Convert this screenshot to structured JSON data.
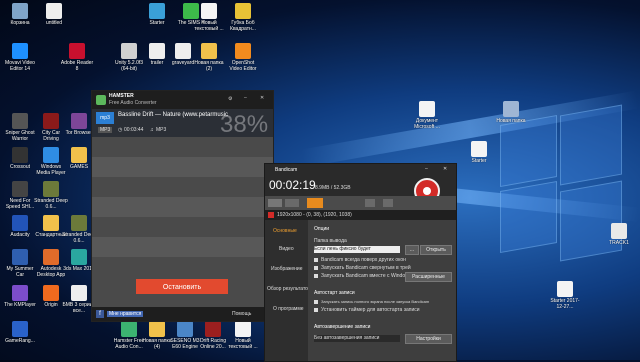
{
  "desktop_icons": [
    {
      "label": "Корзина"
    },
    {
      "label": "untitled"
    },
    {
      "label": "Starter"
    },
    {
      "label": "The SIMS 4"
    },
    {
      "label": "Новый текстовый ..."
    },
    {
      "label": "Губка Боб Квадратн..."
    },
    {
      "label": "Movavi Video Editor 14"
    },
    {
      "label": "Adobe Reader 8"
    },
    {
      "label": "Unity 5.2.0f3 (64-bit)"
    },
    {
      "label": "trailer"
    },
    {
      "label": "graveyard"
    },
    {
      "label": "Новая папка (2)"
    },
    {
      "label": "OpenShot Video Editor"
    },
    {
      "label": "Sniper Ghost Warrior"
    },
    {
      "label": "City Car Driving"
    },
    {
      "label": "Tor Browser"
    },
    {
      "label": "Crossout"
    },
    {
      "label": "Windows Media Player"
    },
    {
      "label": "GAMES"
    },
    {
      "label": "Need For Speed SHI..."
    },
    {
      "label": "Stranded Deep 0.6..."
    },
    {
      "label": "Audacity"
    },
    {
      "label": "Стандартные"
    },
    {
      "label": "Stranded Deep 0.6..."
    },
    {
      "label": "My Summer Car"
    },
    {
      "label": "Autodesk Desktop App"
    },
    {
      "label": "3ds Max 2017"
    },
    {
      "label": "БМВ 3 серии - все..."
    },
    {
      "label": "The KMPlayer"
    },
    {
      "label": "Origin"
    },
    {
      "label": "GameRang..."
    },
    {
      "label": "Hamster Free Audio Con..."
    },
    {
      "label": "Новая папка (4)"
    },
    {
      "label": "SESENO М3 E60 Engine"
    },
    {
      "label": "Drift Racing Online 20..."
    },
    {
      "label": "Новый текстовый ..."
    },
    {
      "label": "Документ Microsoft ..."
    },
    {
      "label": "Новая папка"
    },
    {
      "label": "Starter"
    },
    {
      "label": "Starter 2017-12-27..."
    },
    {
      "label": "TRACK1"
    }
  ],
  "hamster": {
    "title": "HAMSTER",
    "subtitle": "Free Audio Converter",
    "track_name": "Bassline Drift — Nature (www.petarmusic",
    "duration": "00:03:44",
    "format_badge": "MP3",
    "format_label": "MP3",
    "progress_text": "38%",
    "convert_button": "Остановить",
    "like_label": "Мне нравится",
    "help_label": "Помощь"
  },
  "bandicam": {
    "title": "Bandicam",
    "timer": "00:02:19",
    "size": "8.9MB / 52.3GB",
    "target": "1920x1080 - (0, 38), (1920, 1038)",
    "side_items": [
      "Основные",
      "Видео",
      "Изображение",
      "Обзор результатов",
      "О программе"
    ],
    "section_options": "Опции",
    "output_folder_label": "Папка вывода",
    "output_folder_value": "Если лень фиксио будет",
    "browse_button": "...",
    "open_button": "Открыть",
    "options": [
      "Bandicam всегда поверх других окон",
      "Запускать Bandicam свернутым в трей",
      "Запускать Bandicam вместе с Windows"
    ],
    "advanced_button": "Расширенные",
    "autostart_section": "Автостарт записи",
    "autostart_options": [
      "Запускать запись полного экрана после запуска Bandicam",
      "Установить таймер для автостарта записи"
    ],
    "autofinish_section": "Автозавершение записи",
    "autofinish_value": "Без автозавершения записи",
    "settings_button": "Настройки"
  }
}
